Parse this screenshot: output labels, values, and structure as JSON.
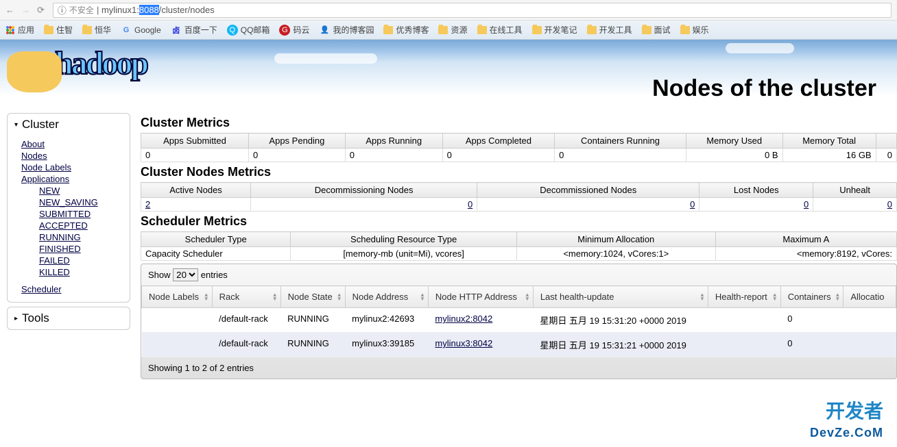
{
  "browser": {
    "insecure_label": "不安全",
    "url_prefix": "mylinux1:",
    "url_highlight": "8088",
    "url_suffix": "/cluster/nodes"
  },
  "bookmarks": {
    "apps": "应用",
    "items": [
      {
        "label": "住智",
        "icon": "folder"
      },
      {
        "label": "恒华",
        "icon": "folder"
      },
      {
        "label": "Google",
        "icon": "g"
      },
      {
        "label": "百度一下",
        "icon": "baidu"
      },
      {
        "label": "QQ邮箱",
        "icon": "qq"
      },
      {
        "label": "码云",
        "icon": "gitee"
      },
      {
        "label": "我的博客园",
        "icon": "blog"
      },
      {
        "label": "优秀博客",
        "icon": "folder"
      },
      {
        "label": "资源",
        "icon": "folder"
      },
      {
        "label": "在线工具",
        "icon": "folder"
      },
      {
        "label": "开发笔记",
        "icon": "folder"
      },
      {
        "label": "开发工具",
        "icon": "folder"
      },
      {
        "label": "面试",
        "icon": "folder"
      },
      {
        "label": "娱乐",
        "icon": "folder"
      }
    ]
  },
  "page_title": "Nodes of the cluster",
  "logo": "hadoop",
  "sidebar": {
    "cluster": "Cluster",
    "tools": "Tools",
    "links": {
      "about": "About",
      "nodes": "Nodes",
      "node_labels": "Node Labels",
      "applications": "Applications",
      "scheduler": "Scheduler"
    },
    "app_states": [
      "NEW",
      "NEW_SAVING",
      "SUBMITTED",
      "ACCEPTED",
      "RUNNING",
      "FINISHED",
      "FAILED",
      "KILLED"
    ]
  },
  "sections": {
    "cluster_metrics": "Cluster Metrics",
    "cluster_nodes_metrics": "Cluster Nodes Metrics",
    "scheduler_metrics": "Scheduler Metrics"
  },
  "cluster_metrics": {
    "headers": [
      "Apps Submitted",
      "Apps Pending",
      "Apps Running",
      "Apps Completed",
      "Containers Running",
      "Memory Used",
      "Memory Total"
    ],
    "values": [
      "0",
      "0",
      "0",
      "0",
      "0",
      "0 B",
      "16 GB",
      "0"
    ]
  },
  "nodes_metrics": {
    "headers": [
      "Active Nodes",
      "Decommissioning Nodes",
      "Decommissioned Nodes",
      "Lost Nodes",
      "Unhealt"
    ],
    "values": [
      "2",
      "0",
      "0",
      "0",
      "0"
    ]
  },
  "scheduler_metrics": {
    "headers": [
      "Scheduler Type",
      "Scheduling Resource Type",
      "Minimum Allocation",
      "Maximum A"
    ],
    "values": [
      "Capacity Scheduler",
      "[memory-mb (unit=Mi), vcores]",
      "<memory:1024, vCores:1>",
      "<memory:8192, vCores:"
    ]
  },
  "datatable": {
    "show_label": "Show",
    "entries_label": "entries",
    "page_size": "20",
    "headers": [
      "Node Labels",
      "Rack",
      "Node State",
      "Node Address",
      "Node HTTP Address",
      "Last health-update",
      "Health-report",
      "Containers",
      "Allocatio"
    ],
    "rows": [
      {
        "labels": "",
        "rack": "/default-rack",
        "state": "RUNNING",
        "addr": "mylinux2:42693",
        "http": "mylinux2:8042",
        "health": "星期日 五月 19 15:31:20 +0000 2019",
        "report": "",
        "containers": "0"
      },
      {
        "labels": "",
        "rack": "/default-rack",
        "state": "RUNNING",
        "addr": "mylinux3:39185",
        "http": "mylinux3:8042",
        "health": "星期日 五月 19 15:31:21 +0000 2019",
        "report": "",
        "containers": "0"
      }
    ],
    "footer": "Showing 1 to 2 of 2 entries"
  },
  "watermark": {
    "cn": "开发者",
    "en": "DevZe.CoM"
  }
}
